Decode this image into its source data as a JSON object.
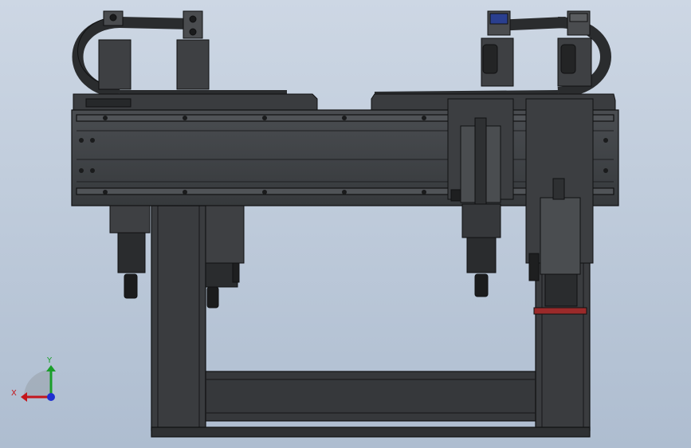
{
  "triad": {
    "x_label": "X",
    "y_label": "Y",
    "x_color": "#c4161c",
    "y_color": "#1a9e2a",
    "z_color": "#1f2fd1"
  },
  "colors": {
    "background_top": "#cdd7e4",
    "background_bottom": "#aebdd0",
    "metal_dark": "#2d2f31",
    "metal_mid": "#3e4043",
    "metal_light": "#55585c",
    "edge": "#101112",
    "accent_red": "#9b2a2a",
    "display_blue": "#2a3f8f"
  }
}
